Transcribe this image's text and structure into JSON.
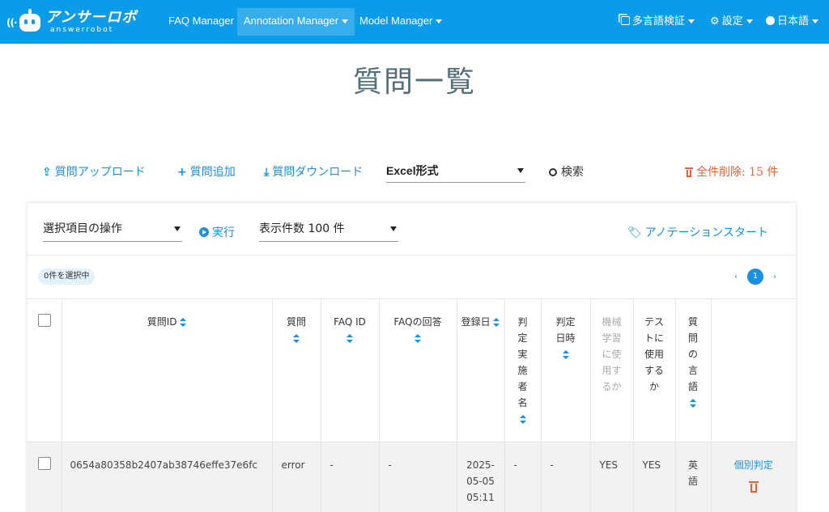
{
  "navbar": {
    "brand_jp": "アンサーロボ",
    "brand_en": "answerrobot",
    "items": [
      {
        "label": "FAQ Manager"
      },
      {
        "label": "Annotation Manager"
      },
      {
        "label": "Model Manager"
      }
    ],
    "right": [
      {
        "label": "多言語検証",
        "icon": "copy-icon"
      },
      {
        "label": "設定",
        "icon": "gear-icon"
      },
      {
        "label": "日本語",
        "icon": "globe-icon"
      }
    ]
  },
  "page": {
    "title": "質問一覧"
  },
  "toolbar": {
    "upload": "質問アップロード",
    "add": "質問追加",
    "download": "質問ダウンロード",
    "format": "Excel形式",
    "search": "検索",
    "delete_all": "全件削除: 15 件"
  },
  "card": {
    "selection_ops": "選択項目の操作",
    "run": "実行",
    "page_size": "表示件数 100 件",
    "annotation_start": "アノテーションスタート",
    "selected_badge": "0件を選択中",
    "pager": {
      "prev": "‹",
      "page": "1",
      "next": "›"
    }
  },
  "table": {
    "headers": [
      "質問ID",
      "質問",
      "FAQ ID",
      "FAQの回答",
      "登録日",
      "判定実施者名",
      "判定日時",
      "機械学習に使用するか",
      "テストに使用するか",
      "質問の言語"
    ],
    "rows": [
      {
        "question_id": "0654a80358b2407ab38746effe37e6fc",
        "question": "error",
        "faq_id": "-",
        "faq_answer": "-",
        "registered": "2025-05-05 05:11",
        "judge_name": "-",
        "judge_date": "-",
        "use_ml": "YES",
        "use_test": "YES",
        "language": "英語",
        "action": "個別判定"
      }
    ]
  },
  "colors": {
    "brand": "#0c9be8",
    "accent": "#1a8fe0",
    "danger": "#e8613a",
    "title": "#546e7a"
  }
}
